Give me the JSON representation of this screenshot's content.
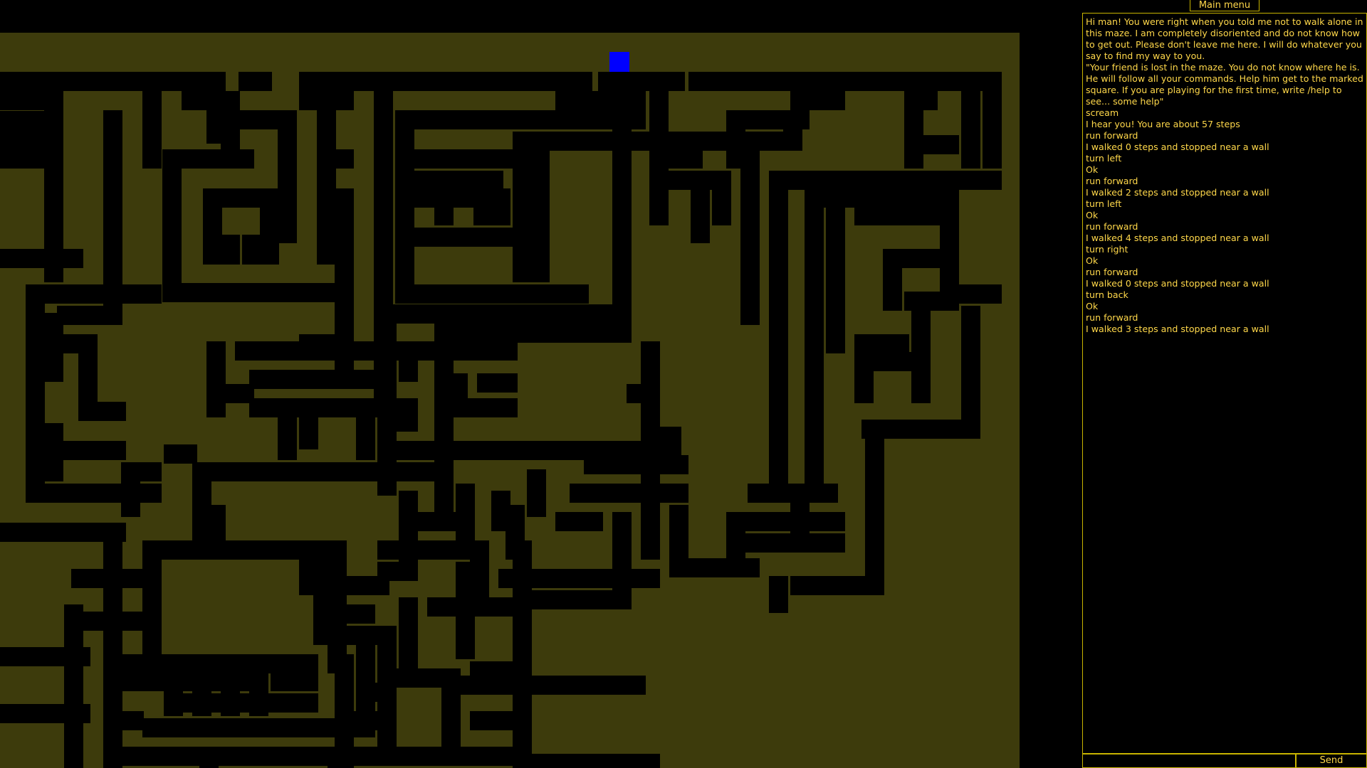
{
  "colors": {
    "background": "#000000",
    "floor": "#3d3b0c",
    "wall": "#000000",
    "player": "#0000ff",
    "text": "#ffd84a",
    "border": "#c8b400"
  },
  "menu": {
    "label": "Main menu"
  },
  "chat": {
    "messages": [
      "Hi man! You were right when you told me not to walk alone in this maze. I am completely disoriented and do not know how to get out. Please don't leave me here. I will do whatever you say to find my way to you.",
      "\"Your friend is lost in the maze. You do not know where he is. He will follow all your commands. Help him get to the marked square. If you are playing for the first time, write /help to see... some help\"",
      "scream",
      "I hear you! You are about 57 steps",
      "run forward",
      "I walked 0 steps and stopped near a wall",
      "turn left",
      "Ok",
      "run forward",
      "I walked 2 steps and stopped near a wall",
      "turn left",
      "Ok",
      "run forward",
      "I walked 4 steps and stopped near a wall",
      "turn right",
      "Ok",
      "run forward",
      "I walked 0 steps and stopped near a wall",
      "turn back",
      "Ok",
      "run forward",
      "I walked 3 steps and stopped near a wall"
    ],
    "input_value": "",
    "send_label": "Send"
  },
  "maze": {
    "marked_square": "target"
  }
}
